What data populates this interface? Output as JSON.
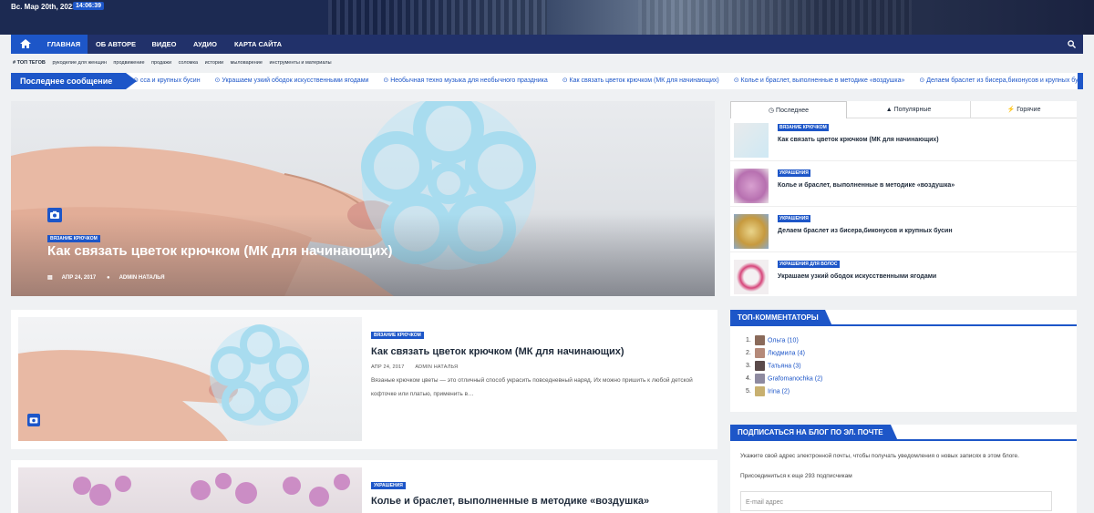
{
  "header": {
    "date": "Вс. Мар 20th, 2022",
    "time": "14:06:39"
  },
  "nav": {
    "items": [
      {
        "label": "ГЛАВНАЯ",
        "active": true
      },
      {
        "label": "ОБ АВТОРЕ",
        "active": false
      },
      {
        "label": "ВИДЕО",
        "active": false
      },
      {
        "label": "АУДИО",
        "active": false
      },
      {
        "label": "КАРТА САЙТА",
        "active": false
      }
    ],
    "home_icon": "home-icon",
    "search_icon": "search-icon"
  },
  "tags": {
    "label": "ТОП ТЕГОВ",
    "items": [
      "рукоделие для женщин",
      "продвижение",
      "продажи",
      "соломка",
      "истории",
      "мыловарение",
      "инструменты и материалы"
    ]
  },
  "ticker": {
    "label": "Последнее сообщение",
    "items": [
      "сса и крупных бусин",
      "Украшаем узкий ободок искусственными ягодами",
      "Необычная техно музыка для необычного праздника",
      "Как связать цветок крючком (МК для начинающих)",
      "Колье и браслет, выполненные в методике «воздушка»",
      "Делаем браслет из бисера,биконусов и крупных бу"
    ]
  },
  "hero": {
    "category": "ВЯЗАНИЕ КРЮЧКОМ",
    "title": "Как связать цветок крючком (МК для начинающих)",
    "date": "АПР 24, 2017",
    "author": "ADMIN НАТАЛЬЯ",
    "camera_icon": "camera-icon"
  },
  "posts": [
    {
      "category": "ВЯЗАНИЕ КРЮЧКОМ",
      "title": "Как связать цветок крючком (МК для начинающих)",
      "date": "АПР 24, 2017",
      "author": "ADMIN НАТАЛЬЯ",
      "excerpt": "Вязаные крючком цветы — это отличный способ украсить повседневный наряд. Их можно пришить к любой детской кофточке или платью, применить в…"
    },
    {
      "category": "УКРАШЕНИЯ",
      "title": "Колье и браслет, выполненные в методике «воздушка»"
    }
  ],
  "sidebar_tabs": {
    "tabs": [
      {
        "label": "Последнее",
        "icon": "clock-icon",
        "active": true
      },
      {
        "label": "Популярные",
        "icon": "fire-icon",
        "active": false
      },
      {
        "label": "Горячие",
        "icon": "bolt-icon",
        "active": false
      }
    ],
    "posts": [
      {
        "category": "ВЯЗАНИЕ КРЮЧКОМ",
        "title": "Как связать цветок крючком (МК для начинающих)"
      },
      {
        "category": "УКРАШЕНИЯ",
        "title": "Колье и браслет, выполненные в методике «воздушка»"
      },
      {
        "category": "УКРАШЕНИЯ",
        "title": "Делаем браслет из бисера,биконусов и крупных бусин"
      },
      {
        "category": "УКРАШЕНИЯ ДЛЯ ВОЛОС",
        "title": "Украшаем узкий ободок искусственными ягодами"
      }
    ]
  },
  "top_commenters": {
    "title": "ТОП-КОММЕНТАТОРЫ",
    "items": [
      {
        "num": "1.",
        "name": "Ольга (10)"
      },
      {
        "num": "2.",
        "name": "Людмила (4)"
      },
      {
        "num": "3.",
        "name": "Татьяна (3)"
      },
      {
        "num": "4.",
        "name": "Grafomanochka (2)"
      },
      {
        "num": "5.",
        "name": "Irina (2)"
      }
    ]
  },
  "subscribe": {
    "title": "ПОДПИСАТЬСЯ НА БЛОГ ПО ЭЛ. ПОЧТЕ",
    "text": "Укажите свой адрес электронной почты, чтобы получать уведомления о новых записях в этом блоге.",
    "count_text": "Присоединиться к еще 293 подписчикам",
    "email_placeholder": "E-mail адрес"
  },
  "colors": {
    "accent": "#1d56c8",
    "nav_bg": "#21316a"
  }
}
